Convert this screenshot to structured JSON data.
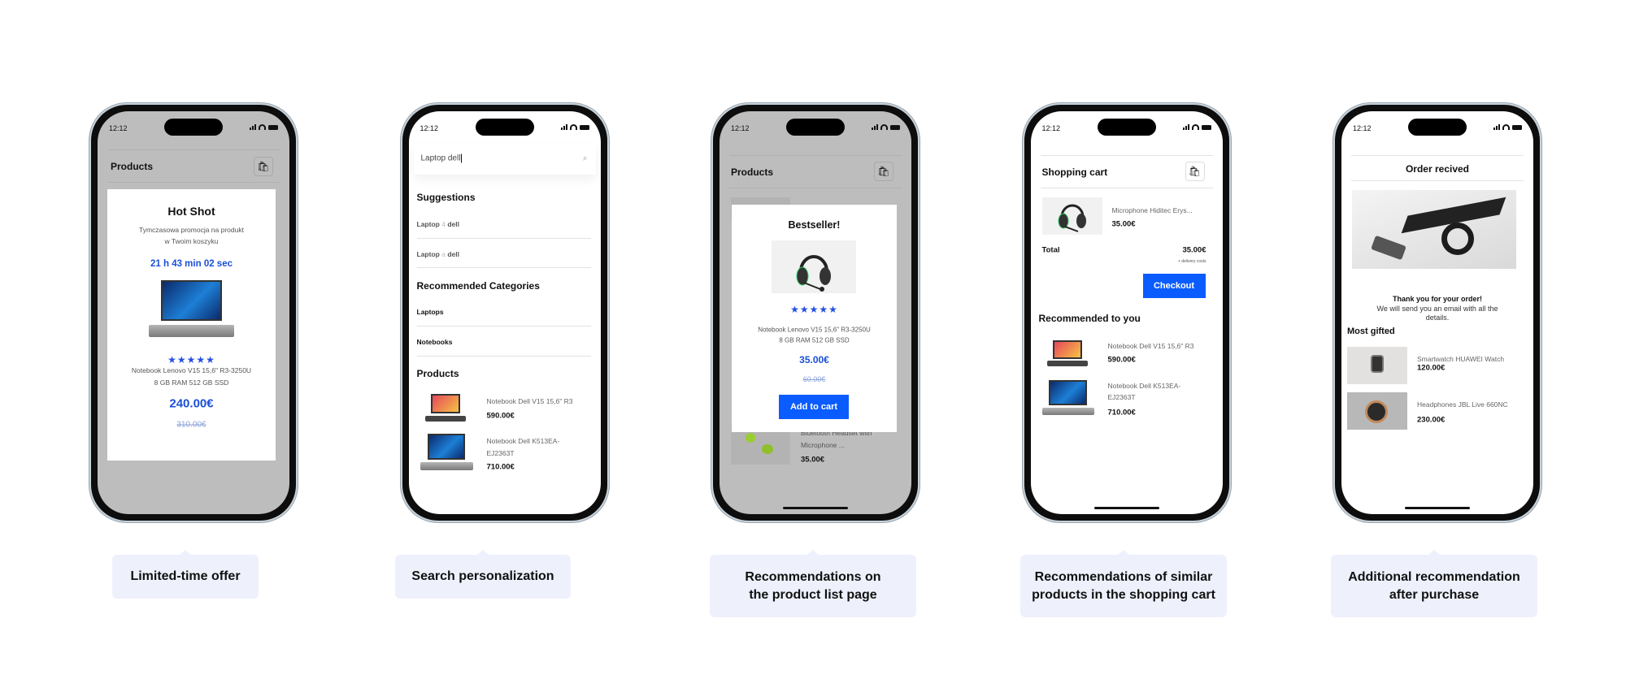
{
  "status_time": "12:12",
  "colors": {
    "accent": "#0a5cff",
    "price_blue": "#1a4fd6",
    "caption_bg": "#eef1fc",
    "overlay": "#bdbdbd"
  },
  "phones": [
    {
      "header": "Products",
      "popup": {
        "title": "Hot Shot",
        "subtitle_1": "Tymczasowa promocja na produkt",
        "subtitle_2": "w Twoim koszyku",
        "timer": "21 h 43 min 02 sec",
        "rating": 5,
        "stars": "★★★★★",
        "desc_1": "Notebook Lenovo V15 15,6\" R3-3250U",
        "desc_2": "8 GB RAM 512 GB SSD",
        "price": "240.00€",
        "old_price": "310.00€"
      }
    },
    {
      "search_value": "Laptop dell",
      "suggestions_title": "Suggestions",
      "suggestions": [
        {
          "a": "Laptop",
          "mid": "4",
          "b": "dell"
        },
        {
          "a": "Laptop",
          "mid": "a",
          "b": "dell"
        }
      ],
      "categories_title": "Recommended Categories",
      "categories": [
        "Laptops",
        "Notebooks"
      ],
      "products_title": "Products",
      "products": [
        {
          "name_1": "Notebook Dell V15 15,6\" R3",
          "name_2": "",
          "price": "590.00€"
        },
        {
          "name_1": "Notebook Dell K513EA-",
          "name_2": "EJ2363T",
          "price": "710.00€"
        }
      ]
    },
    {
      "header": "Products",
      "background_item": {
        "name_1": "Bluetooth Headset with",
        "name_2": "Microphone ...",
        "price": "35.00€"
      },
      "popup": {
        "title": "Bestseller!",
        "rating": 5,
        "stars": "★★★★★",
        "desc_1": "Notebook Lenovo V15 15,6\" R3-3250U",
        "desc_2": "8 GB RAM 512 GB SSD",
        "price": "35.00€",
        "old_price": "60.00€",
        "button": "Add to cart"
      }
    },
    {
      "header": "Shopping cart",
      "cart_item": {
        "name": "Microphone Hiditec Erys...",
        "price": "35.00€"
      },
      "total_label": "Total",
      "total_value": "35.00€",
      "delivery_note": "+ delivery costs",
      "checkout": "Checkout",
      "recommended_title": "Recommended to you",
      "products": [
        {
          "name_1": "Notebook Dell V15 15,6\" R3",
          "name_2": "",
          "price": "590.00€"
        },
        {
          "name_1": "Notebook Dell K513EA-",
          "name_2": "EJ2363T",
          "price": "710.00€"
        }
      ]
    },
    {
      "header": "Order recived",
      "thanks": "Thank you for your order!",
      "message_1": "We will send you an email with all the",
      "message_2": "details.",
      "gifted_title": "Most gifted",
      "products": [
        {
          "name": "Smartwatch HUAWEI Watch",
          "price": "120.00€"
        },
        {
          "name": "Headphones JBL Live 660NC",
          "price": "230.00€"
        }
      ]
    }
  ],
  "captions": [
    {
      "line_1": "Limited-time offer",
      "line_2": ""
    },
    {
      "line_1": "Search personalization",
      "line_2": ""
    },
    {
      "line_1": "Recommendations on",
      "line_2": "the product list page"
    },
    {
      "line_1": "Recommendations of similar",
      "line_2": "products in the shopping cart"
    },
    {
      "line_1": "Additional recommendation",
      "line_2": "after purchase"
    }
  ]
}
